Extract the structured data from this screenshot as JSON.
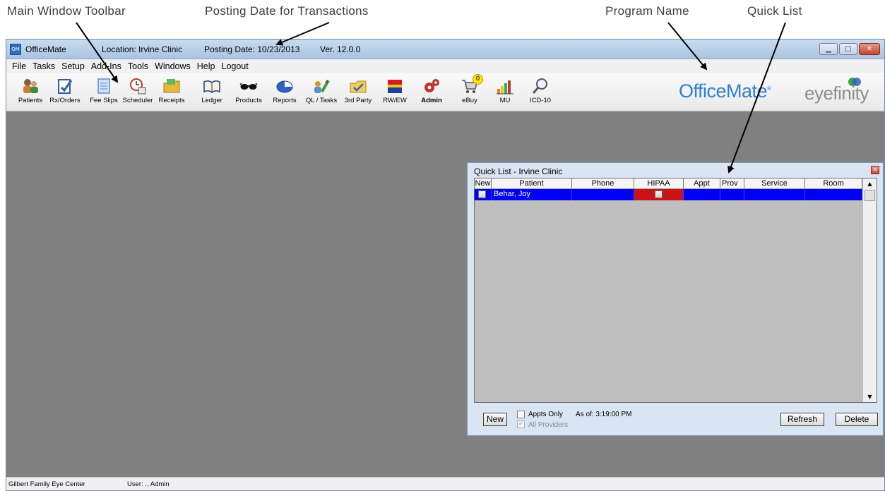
{
  "callouts": {
    "main_toolbar": "Main Window Toolbar",
    "posting_date": "Posting Date for Transactions",
    "program_name": "Program Name",
    "quick_list": "Quick List"
  },
  "window": {
    "app_name": "OfficeMate",
    "icon_text": "OM",
    "location": "Location: Irvine Clinic",
    "posting_date": "Posting Date: 10/23/2013",
    "version": "Ver. 12.0.0"
  },
  "menu": [
    "File",
    "Tasks",
    "Setup",
    "Add-Ins",
    "Tools",
    "Windows",
    "Help",
    "Logout"
  ],
  "toolbar": {
    "tools": [
      {
        "label": "Patients",
        "icon": "patients-icon"
      },
      {
        "label": "Rx/Orders",
        "icon": "rx-orders-icon"
      },
      {
        "label": "Fee Slips",
        "icon": "fee-slips-icon"
      },
      {
        "label": "Scheduler",
        "icon": "scheduler-icon"
      },
      {
        "label": "Receipts",
        "icon": "receipts-icon"
      },
      {
        "label": "Ledger",
        "icon": "ledger-icon"
      },
      {
        "label": "Products",
        "icon": "products-icon"
      },
      {
        "label": "Reports",
        "icon": "reports-icon"
      },
      {
        "label": "QL / Tasks",
        "icon": "ql-tasks-icon"
      },
      {
        "label": "3rd Party",
        "icon": "third-party-icon"
      },
      {
        "label": "RW/EW",
        "icon": "rw-ew-icon"
      },
      {
        "label": "Admin",
        "icon": "admin-icon"
      },
      {
        "label": "eBuy",
        "icon": "ebuy-icon"
      },
      {
        "label": "MU",
        "icon": "mu-icon"
      },
      {
        "label": "ICD-10",
        "icon": "icd-10-icon"
      }
    ],
    "ebuy_badge": "0",
    "brand_officemate": "OfficeMate",
    "brand_eyefinity": "eyefinity"
  },
  "quick_list": {
    "title": "Quick List - Irvine Clinic",
    "columns": [
      "New",
      "Patient",
      "Phone",
      "HIPAA",
      "Appt",
      "Prov",
      "Service",
      "Room"
    ],
    "rows": [
      {
        "new": "",
        "patient": "Behar, Joy",
        "phone": "",
        "hipaa": "",
        "appt": "",
        "prov": "",
        "service": "",
        "room": ""
      }
    ],
    "new_button": "New",
    "appts_only": "Appts Only",
    "all_providers": "All Providers",
    "as_of": "As of: 3:19:00 PM",
    "refresh_button": "Refresh",
    "delete_button": "Delete"
  },
  "status": {
    "practice": "Gilbert Family Eye Center",
    "user": "User: ., Admin"
  },
  "colors": {
    "selected_row": "#0000f0",
    "hipaa_cell": "#c81414",
    "brand_blue": "#2f7fd2",
    "desktop": "#808080"
  }
}
